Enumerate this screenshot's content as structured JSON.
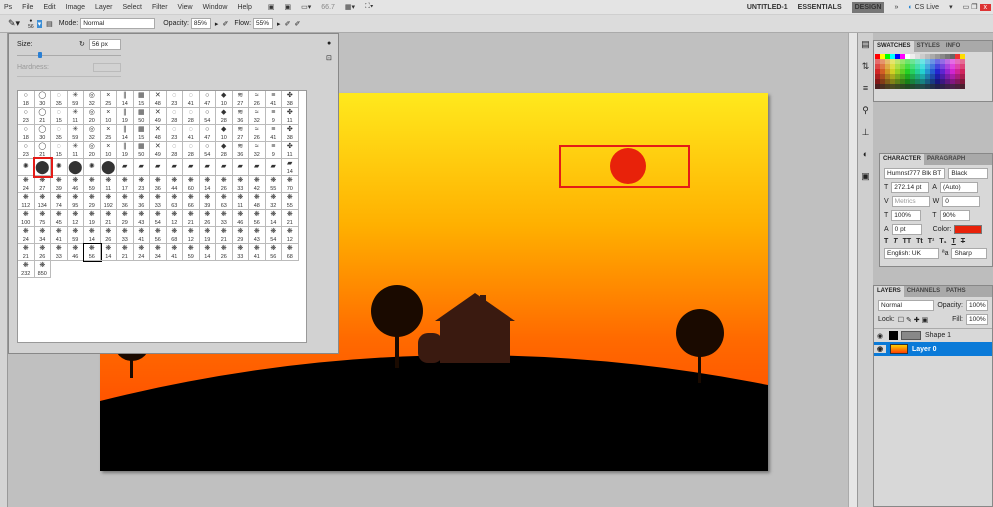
{
  "menu": {
    "logo": "Ps",
    "items": [
      "File",
      "Edit",
      "Image",
      "Layer",
      "Select",
      "Filter",
      "View",
      "Window",
      "Help"
    ],
    "zoom": "66.7",
    "workspaces": [
      "UNTITLED-1",
      "ESSENTIALS",
      "DESIGN"
    ],
    "more": "»",
    "cslive": "CS Live"
  },
  "options": {
    "brush_size": "56",
    "mode_label": "Mode:",
    "mode": "Normal",
    "opacity_label": "Opacity:",
    "opacity": "85%",
    "flow_label": "Flow:",
    "flow": "55%"
  },
  "brush_panel": {
    "size_label": "Size:",
    "size": "56 px",
    "hardness_label": "Hardness:",
    "size_fraction": 0.2,
    "rows": [
      [
        "18",
        "30",
        "35",
        "59",
        "32",
        "25",
        "14",
        "15",
        "48",
        "23",
        "41",
        "47",
        "10",
        "27",
        "26",
        "41",
        "38"
      ],
      [
        "23",
        "21",
        "15",
        "11",
        "20",
        "10",
        "19",
        "50",
        "49",
        "28",
        "28",
        "54",
        "28",
        "36",
        "32",
        "9",
        "11"
      ],
      [
        "18",
        "30",
        "35",
        "59",
        "32",
        "25",
        "14",
        "15",
        "48",
        "23",
        "41",
        "47",
        "10",
        "27",
        "26",
        "41",
        "38"
      ],
      [
        "23",
        "21",
        "15",
        "11",
        "20",
        "10",
        "19",
        "50",
        "49",
        "28",
        "28",
        "54",
        "28",
        "36",
        "32",
        "9",
        "11"
      ],
      [
        "",
        "",
        "",
        "",
        "",
        "",
        "",
        "",
        "",
        "",
        "",
        "",
        "",
        "",
        "",
        "",
        "14"
      ],
      [
        "24",
        "27",
        "39",
        "46",
        "59",
        "11",
        "17",
        "23",
        "36",
        "44",
        "60",
        "14",
        "26",
        "33",
        "42",
        "55",
        "70"
      ],
      [
        "112",
        "134",
        "74",
        "95",
        "29",
        "192",
        "36",
        "36",
        "33",
        "63",
        "66",
        "39",
        "63",
        "11",
        "48",
        "32",
        "55"
      ],
      [
        "100",
        "75",
        "45",
        "12",
        "19",
        "21",
        "29",
        "43",
        "54",
        "12",
        "21",
        "26",
        "33",
        "46",
        "56",
        "14",
        "21"
      ],
      [
        "24",
        "34",
        "41",
        "59",
        "14",
        "26",
        "33",
        "41",
        "56",
        "68",
        "12",
        "19",
        "21",
        "29",
        "43",
        "54",
        "12"
      ],
      [
        "21",
        "26",
        "33",
        "46",
        "56",
        "14",
        "21",
        "24",
        "34",
        "41",
        "59",
        "14",
        "26",
        "33",
        "41",
        "56",
        "68"
      ],
      [
        "232",
        "850"
      ]
    ]
  },
  "swatches": {
    "tabs": [
      "SWATCHES",
      "STYLES",
      "INFO"
    ]
  },
  "character": {
    "tabs": [
      "CHARACTER",
      "PARAGRAPH"
    ],
    "font": "Humnst777 Blk BT",
    "style": "Black",
    "size": "272.14 pt",
    "leading": "(Auto)",
    "kerning": "Metrics",
    "tracking": "0",
    "vscale": "100%",
    "hscale": "90%",
    "baseline": "0 pt",
    "color_label": "Color:",
    "color": "#e8220a",
    "styles": [
      "T",
      "T",
      "TT",
      "Tt",
      "T¹",
      "T₁",
      "T",
      "T"
    ],
    "language": "English: UK",
    "aa_label": "ªa",
    "aa": "Sharp"
  },
  "layers": {
    "tabs": [
      "LAYERS",
      "CHANNELS",
      "PATHS"
    ],
    "blend": "Normal",
    "opacity_label": "Opacity:",
    "opacity": "100%",
    "lock_label": "Lock:",
    "fill_label": "Fill:",
    "fill": "100%",
    "items": [
      {
        "name": "Shape 1"
      },
      {
        "name": "Layer 0"
      }
    ]
  },
  "colors": {
    "selection": "#0a7ad8",
    "highlight": "#e41b17"
  }
}
